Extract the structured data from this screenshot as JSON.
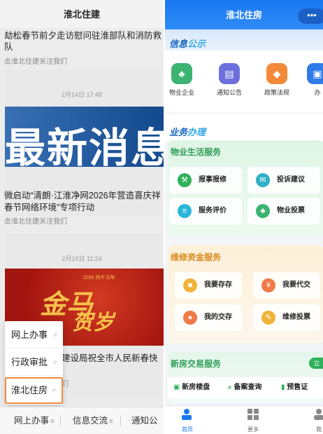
{
  "left": {
    "header_title": "淮北住建",
    "msg1_title": "劫松春节前夕走访慰问驻淮部队和消防救",
    "msg1_title2": "队",
    "msg1_sub": "击淮北住建关注我们",
    "msg2_date": "2月14日 17:48",
    "msg2_banner_text": "最新消息",
    "msg2_title1": "微启动“清朗·江淮净网2026年营造喜庆祥",
    "msg2_title2": "春节网络环境”专项行动",
    "msg2_sub": "击淮北住建关注我们",
    "msg3_date": "2月16日 11:24",
    "msg3_banner_big": "金马",
    "msg3_banner_big2": "贺岁",
    "msg3_banner_small": "2026 丙午马年",
    "msg3_title": "建设局祝全市人民新春快",
    "msg3_sub": "们",
    "popup_items": [
      "网上办事",
      "行政审批",
      "淮北住房"
    ],
    "bottom_nav": [
      "网上办事",
      "信息交流",
      "通知公"
    ]
  },
  "right": {
    "title": "淮北住房",
    "capsule": "•••",
    "info_section_title_a": "信息",
    "info_section_title_b": "公示",
    "info_buttons": [
      {
        "label": "物业企业",
        "color": "#3cb371",
        "icon": "tree-icon"
      },
      {
        "label": "通知公告",
        "color": "#6c6fdc",
        "icon": "bulletin-icon"
      },
      {
        "label": "政策法规",
        "color": "#f28a3a",
        "icon": "tag-icon"
      },
      {
        "label": "办",
        "color": "#2f7ce8",
        "icon": "doc-icon"
      }
    ],
    "business_title_a": "业务",
    "business_title_b": "办理",
    "property_title": "物业生活服务",
    "property_buttons": [
      {
        "label": "报事报修",
        "color": "#2fb05a",
        "icon": "wrench-icon"
      },
      {
        "label": "投诉建议",
        "color": "#2fb0c8",
        "icon": "chat-icon"
      },
      {
        "label": "服务评价",
        "color": "#29b6d8",
        "icon": "comment-icon"
      },
      {
        "label": "物业投票",
        "color": "#3cb371",
        "icon": "tree-icon"
      }
    ],
    "fund_title": "维修资金服务",
    "fund_buttons": [
      {
        "label": "我要存存",
        "color": "#f0b43a",
        "icon": "deposit-icon"
      },
      {
        "label": "我要代交",
        "color": "#ef7a48",
        "icon": "yen-icon"
      },
      {
        "label": "我的交存",
        "color": "#ef7a48",
        "icon": "hand-coin-icon"
      },
      {
        "label": "维修投票",
        "color": "#f0b43a",
        "icon": "vote-icon"
      }
    ],
    "newhouse_title": "新房交易服务",
    "newhouse_badge": "立",
    "newhouse_items": [
      "新房楼盘",
      "备案查询",
      "预售证"
    ],
    "tabs": [
      "首页",
      "更多",
      "我"
    ]
  }
}
